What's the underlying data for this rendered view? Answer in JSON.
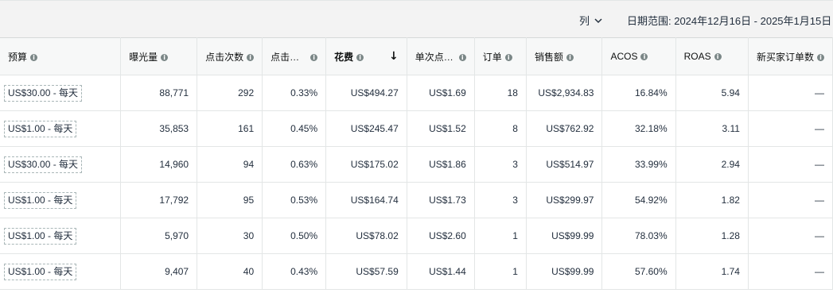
{
  "toolbar": {
    "columns_label": "列",
    "date_range_label": "日期范围: 2024年12月16日 - 2025年1月15日"
  },
  "columns": [
    {
      "label": "预算",
      "sorted": false
    },
    {
      "label": "曝光量",
      "sorted": false
    },
    {
      "label": "点击次数",
      "sorted": false
    },
    {
      "label": "点击…",
      "sorted": false
    },
    {
      "label": "花费",
      "sorted": true
    },
    {
      "label": "单次点…",
      "sorted": false
    },
    {
      "label": "订单",
      "sorted": false
    },
    {
      "label": "销售额",
      "sorted": false
    },
    {
      "label": "ACOS",
      "sorted": false
    },
    {
      "label": "ROAS",
      "sorted": false
    },
    {
      "label": "新买家订单数",
      "sorted": false
    }
  ],
  "rows": [
    {
      "budget": "US$30.00 - 每天",
      "impressions": "88,771",
      "clicks": "292",
      "ctr": "0.33%",
      "spend": "US$494.27",
      "cpc": "US$1.69",
      "orders": "18",
      "sales": "US$2,934.83",
      "acos": "16.84%",
      "roas": "5.94",
      "new_buyer_orders": "—"
    },
    {
      "budget": "US$1.00 - 每天",
      "impressions": "35,853",
      "clicks": "161",
      "ctr": "0.45%",
      "spend": "US$245.47",
      "cpc": "US$1.52",
      "orders": "8",
      "sales": "US$762.92",
      "acos": "32.18%",
      "roas": "3.11",
      "new_buyer_orders": "—"
    },
    {
      "budget": "US$30.00 - 每天",
      "impressions": "14,960",
      "clicks": "94",
      "ctr": "0.63%",
      "spend": "US$175.02",
      "cpc": "US$1.86",
      "orders": "3",
      "sales": "US$514.97",
      "acos": "33.99%",
      "roas": "2.94",
      "new_buyer_orders": "—"
    },
    {
      "budget": "US$1.00 - 每天",
      "impressions": "17,792",
      "clicks": "95",
      "ctr": "0.53%",
      "spend": "US$164.74",
      "cpc": "US$1.73",
      "orders": "3",
      "sales": "US$299.97",
      "acos": "54.92%",
      "roas": "1.82",
      "new_buyer_orders": "—"
    },
    {
      "budget": "US$1.00 - 每天",
      "impressions": "5,970",
      "clicks": "30",
      "ctr": "0.50%",
      "spend": "US$78.02",
      "cpc": "US$2.60",
      "orders": "1",
      "sales": "US$99.99",
      "acos": "78.03%",
      "roas": "1.28",
      "new_buyer_orders": "—"
    },
    {
      "budget": "US$1.00 - 每天",
      "impressions": "9,407",
      "clicks": "40",
      "ctr": "0.43%",
      "spend": "US$57.59",
      "cpc": "US$1.44",
      "orders": "1",
      "sales": "US$99.99",
      "acos": "57.60%",
      "roas": "1.74",
      "new_buyer_orders": "—"
    }
  ]
}
